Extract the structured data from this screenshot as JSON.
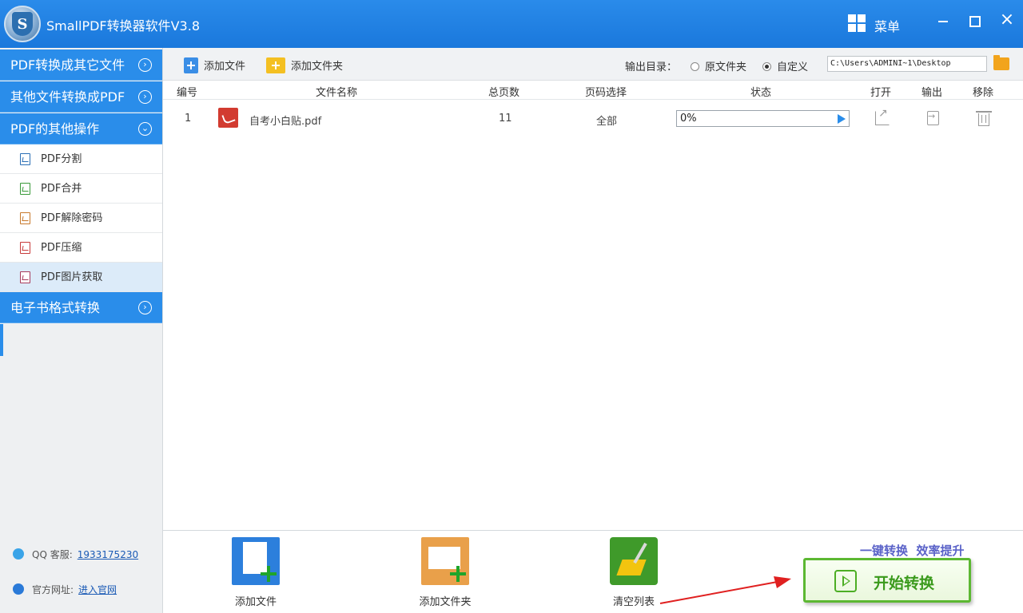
{
  "window": {
    "title": "SmallPDF转换器软件V3.8",
    "menu_label": "菜单",
    "minimize_label": "",
    "close_label": "×"
  },
  "sidebar": {
    "categories": [
      {
        "label": "PDF转换成其它文件",
        "state": "collapsed"
      },
      {
        "label": "其他文件转换成PDF",
        "state": "collapsed"
      },
      {
        "label": "PDF的其他操作",
        "state": "expanded"
      },
      {
        "label": "电子书格式转换",
        "state": "collapsed"
      }
    ],
    "sub_items": [
      {
        "label": "PDF分割",
        "icon_color": "#2a6fb5"
      },
      {
        "label": "PDF合并",
        "icon_color": "#3a9a3a"
      },
      {
        "label": "PDF解除密码",
        "icon_color": "#c7782a"
      },
      {
        "label": "PDF压缩",
        "icon_color": "#c83a3a"
      },
      {
        "label": "PDF图片获取",
        "icon_color": "#a83a5a"
      }
    ],
    "active_sub_item": "PDF图片获取",
    "contact": {
      "qq_label": "QQ 客服:",
      "qq_value": "1933175230",
      "site_label": "官方网址:",
      "site_value": "进入官网"
    }
  },
  "toolbar": {
    "add_file_label": "添加文件",
    "add_folder_label": "添加文件夹",
    "output_dir_label": "输出目录：",
    "option_original": "原文件夹",
    "option_custom": "自定义",
    "selected_option": "自定义",
    "path_value": "C:\\Users\\ADMINI~1\\Desktop"
  },
  "table": {
    "columns": [
      "编号",
      "文件名称",
      "总页数",
      "页码选择",
      "状态",
      "打开",
      "输出",
      "移除"
    ],
    "rows": [
      {
        "index": "1",
        "file_name": "自考小白贴.pdf",
        "pages": "11",
        "page_selection": "全部",
        "progress_text": "0%",
        "progress": 0
      }
    ]
  },
  "bottom": {
    "add_file_label": "添加文件",
    "add_folder_label": "添加文件夹",
    "clear_list_label": "清空列表",
    "slogan": "一键转换  效率提升",
    "start_label": "开始转换"
  },
  "colors": {
    "accent": "#2a8dea",
    "start_green": "#3a9a1c",
    "slogan": "#5a62c8",
    "annotation_arrow": "#e02020"
  },
  "icons": {
    "menu": "grid-icon",
    "category_collapsed": "circle-chevron-right-icon",
    "category_expanded": "circle-chevron-down-icon",
    "row_open": "external-link-icon",
    "row_output": "export-icon",
    "row_remove": "trash-icon"
  }
}
